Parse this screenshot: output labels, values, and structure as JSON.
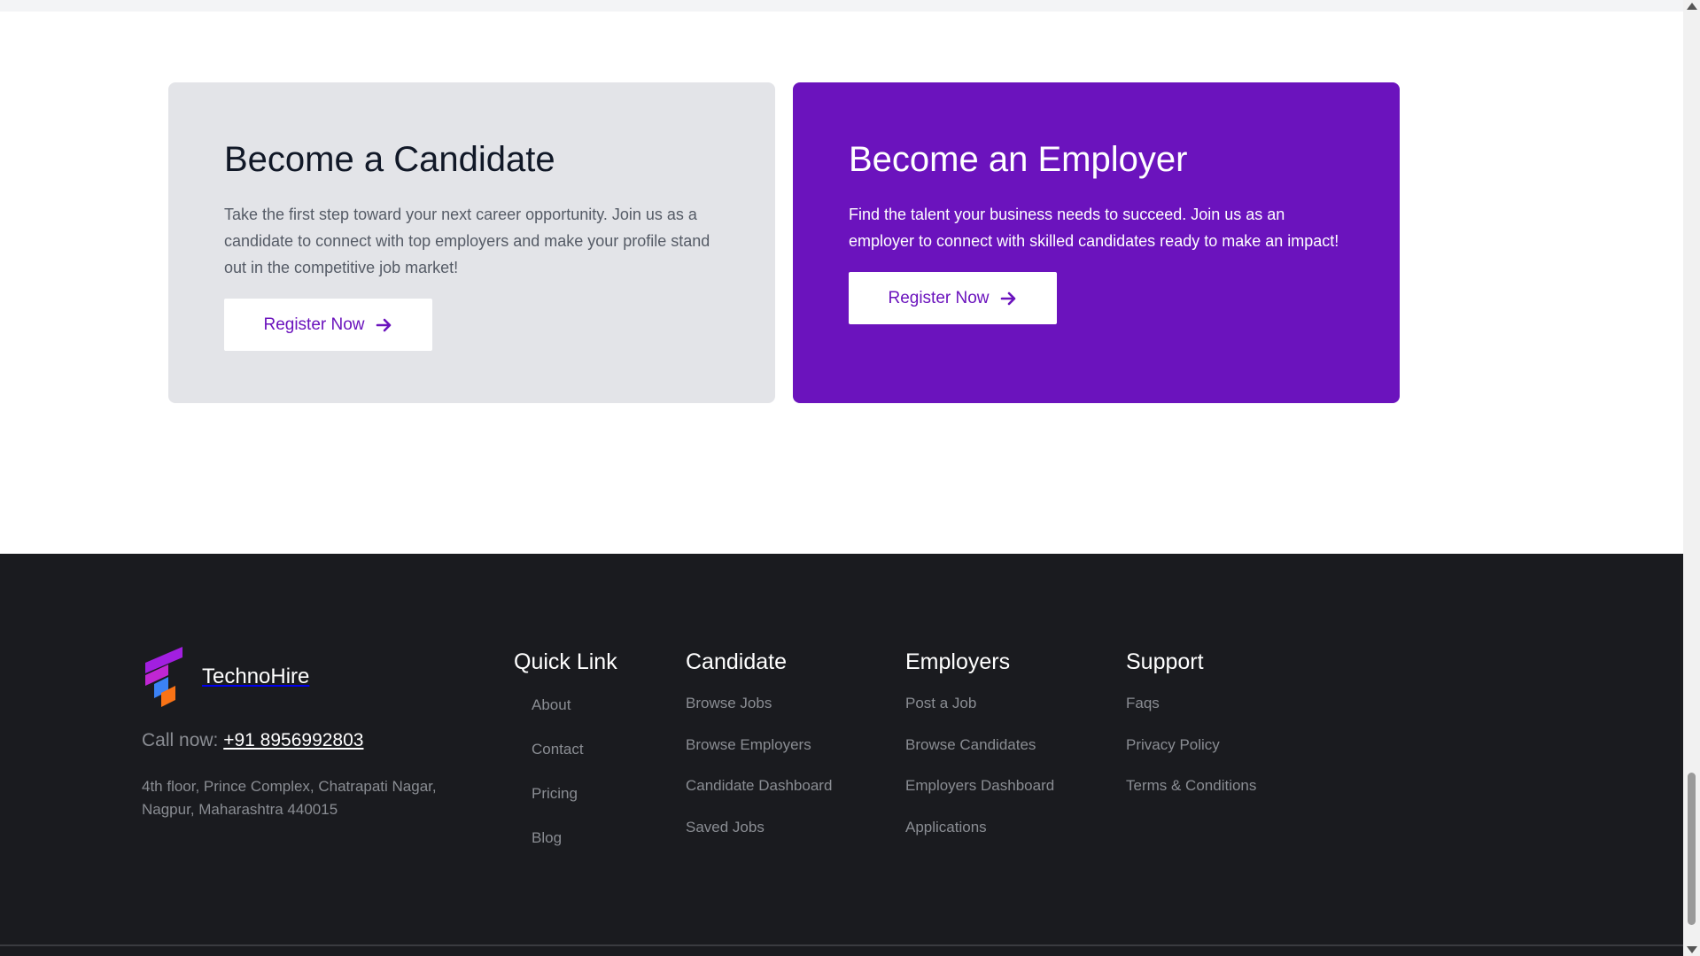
{
  "cards": {
    "candidate": {
      "title": "Become a Candidate",
      "description": "Take the first step toward your next career opportunity. Join us as a candidate to connect with top employers and make your profile stand out in the competitive job market!",
      "button_label": "Register Now"
    },
    "employer": {
      "title": "Become an Employer",
      "description": "Find the talent your business needs to succeed. Join us as an employer to connect with skilled candidates ready to make an impact!",
      "button_label": "Register Now"
    }
  },
  "footer": {
    "brand": "TechnoHire",
    "call_label": "Call now:",
    "phone": "+91 8956992803",
    "address": "4th floor, Prince Complex, Chatrapati Nagar, Nagpur, Maharashtra 440015",
    "quick_links": {
      "title": "Quick Link",
      "items": [
        "About",
        "Contact",
        "Pricing",
        "Blog"
      ]
    },
    "candidate": {
      "title": "Candidate",
      "items": [
        "Browse Jobs",
        "Browse Employers",
        "Candidate Dashboard",
        "Saved Jobs"
      ]
    },
    "employers": {
      "title": "Employers",
      "items": [
        "Post a Job",
        "Browse Candidates",
        "Employers Dashboard",
        "Applications"
      ]
    },
    "support": {
      "title": "Support",
      "items": [
        "Faqs",
        "Privacy Policy",
        "Terms & Conditions"
      ]
    }
  },
  "colors": {
    "accent": "#6b13bd",
    "candidate_card_bg": "#e3e4e8",
    "footer_bg": "#1a1b1f"
  },
  "icons": {
    "register_arrow": "arrow-right-icon",
    "logo": "technohire-logo-icon"
  }
}
